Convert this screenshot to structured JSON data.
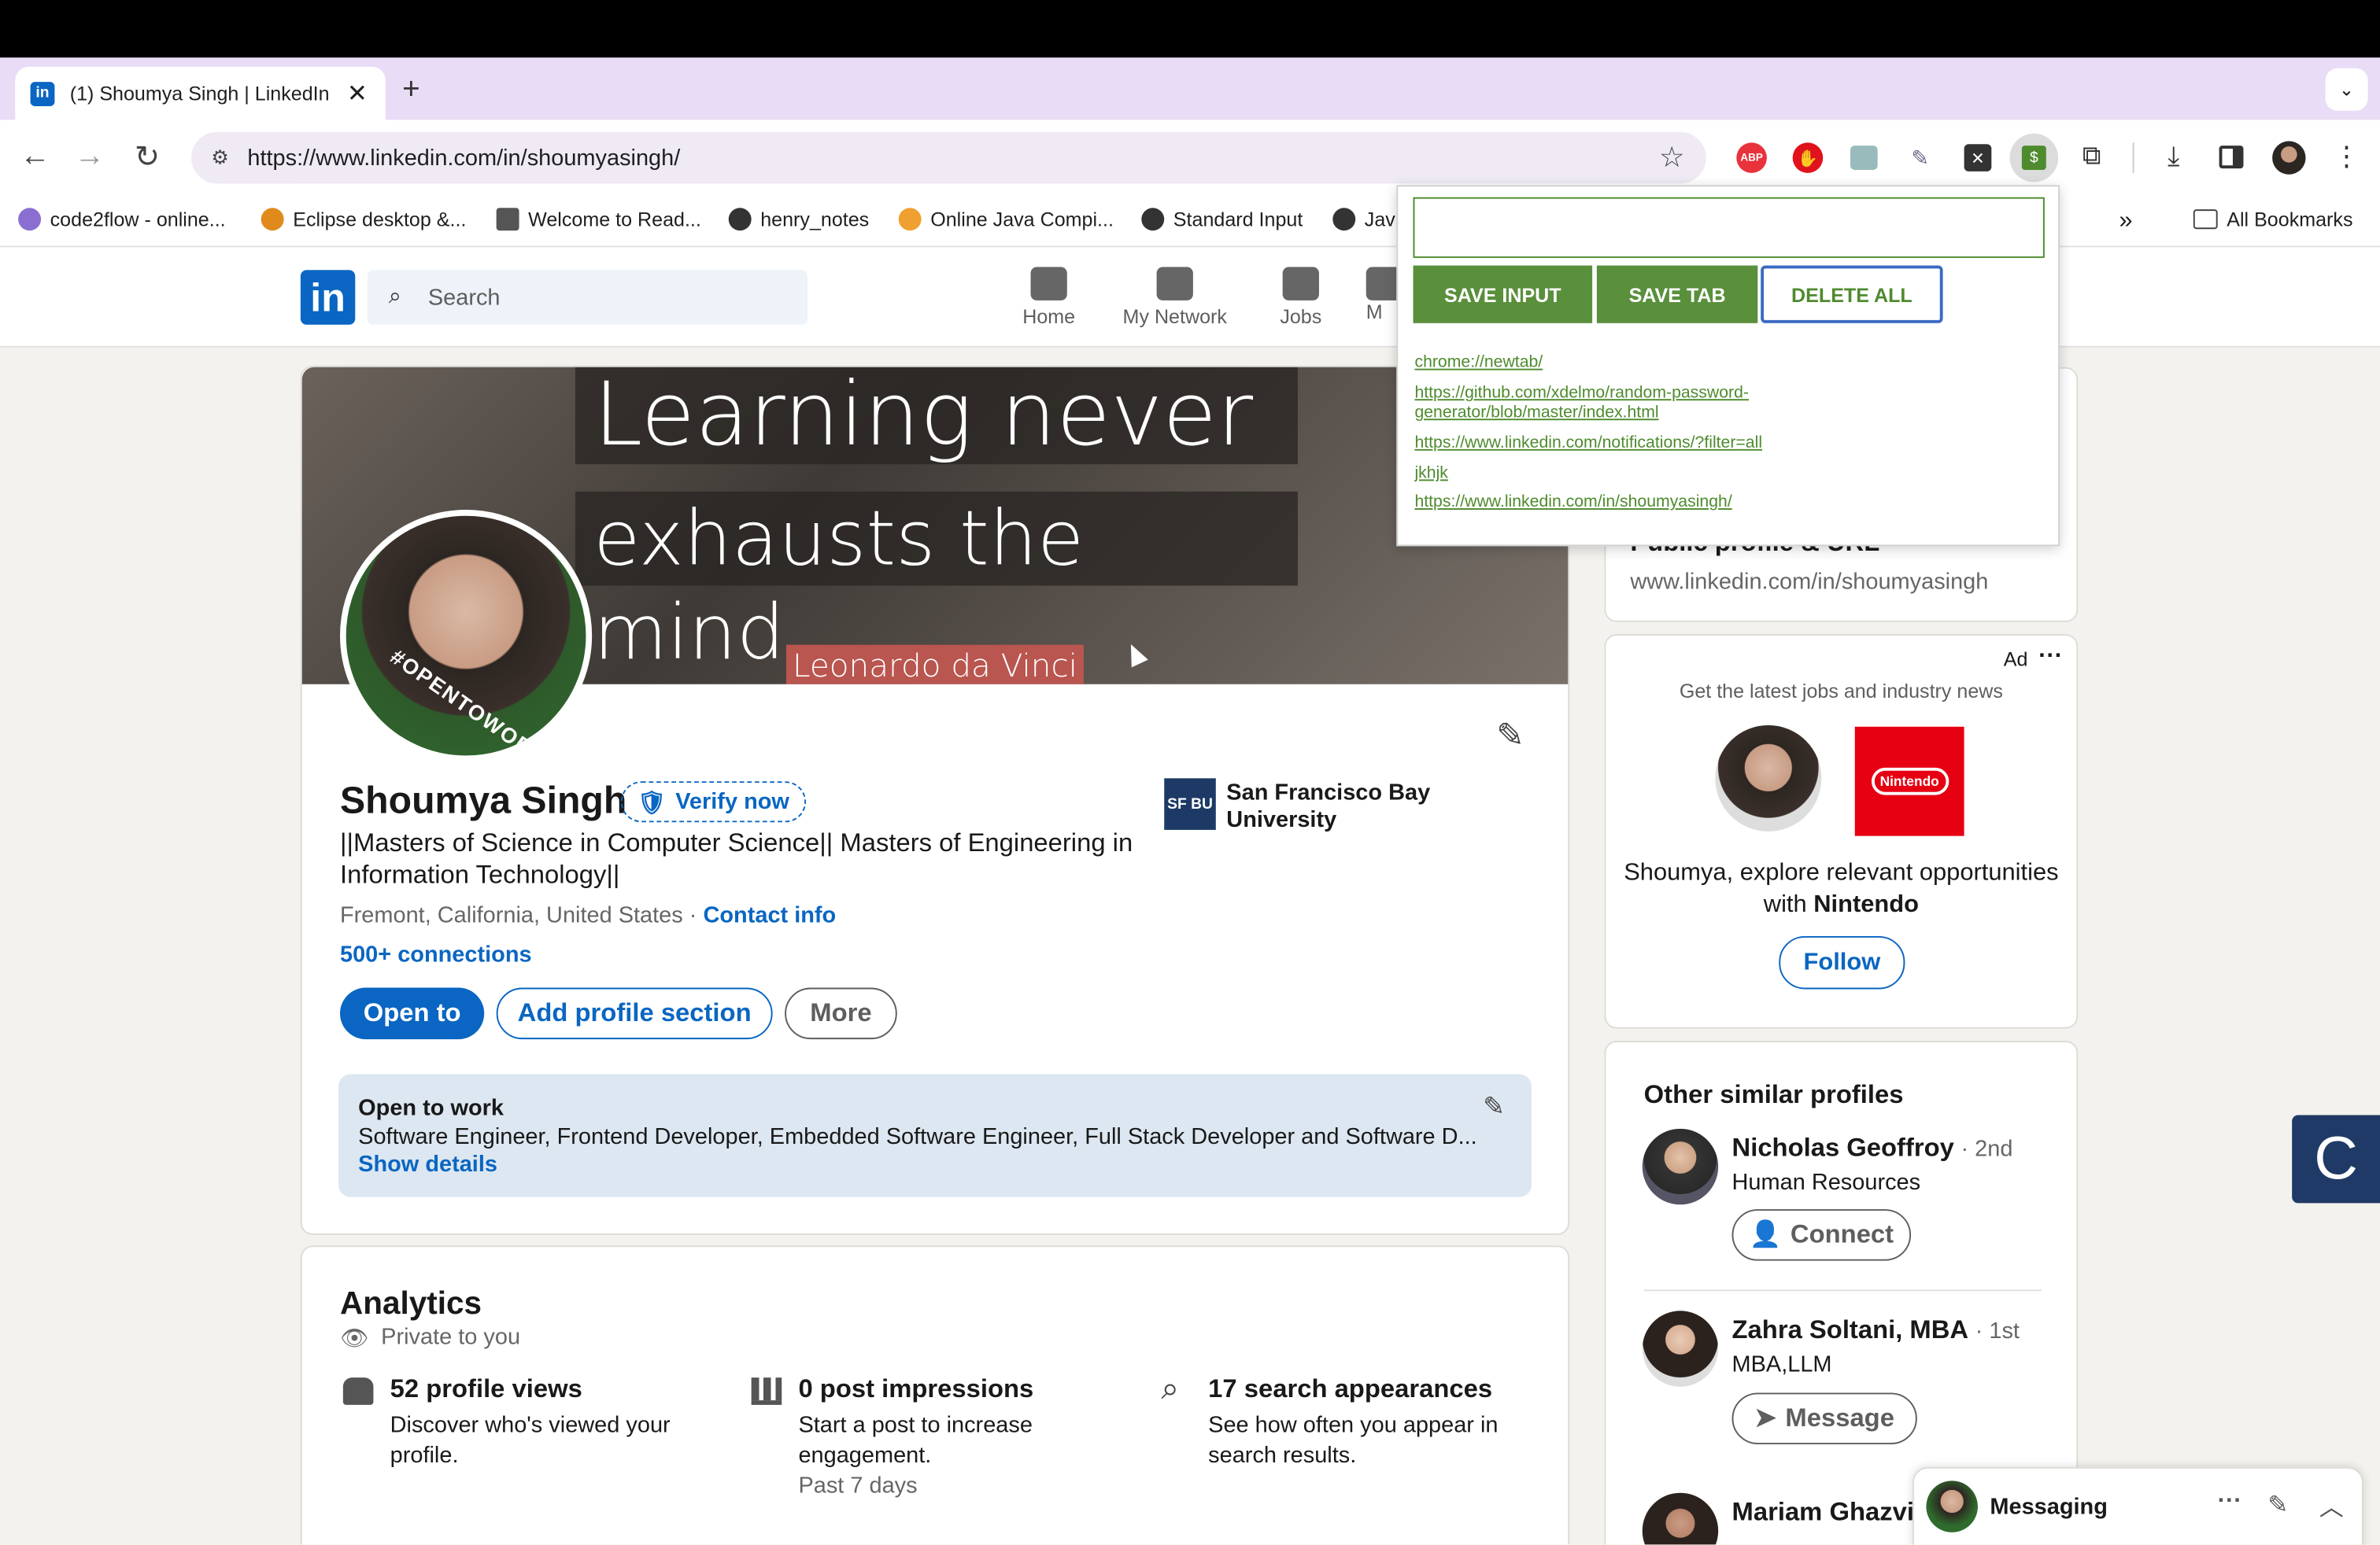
{
  "browser": {
    "tab_title": "(1) Shoumya Singh | LinkedIn",
    "new_tab": "+",
    "url": "https://www.linkedin.com/in/shoumyasingh/",
    "bookmarks": [
      "code2flow - online...",
      "Eclipse desktop &...",
      "Welcome to Read...",
      "henry_notes",
      "Online Java Compi...",
      "Standard Input",
      "Jav"
    ],
    "bookmarks_more": "»",
    "all_bookmarks": "All Bookmarks"
  },
  "nav": {
    "logo": "in",
    "search_placeholder": "Search",
    "items": [
      "Home",
      "My Network",
      "Jobs",
      "M"
    ]
  },
  "cover": {
    "line1": "Learning never",
    "line2": "exhausts the mind.",
    "author": "Leonardo da Vinci",
    "badge": "#OPENTOWORK"
  },
  "profile": {
    "name": "Shoumya Singh",
    "verify": "Verify now",
    "headline": "||Masters of Science in Computer Science|| Masters of Engineering in Information Technology||",
    "location": "Fremont, California, United States",
    "separator": "·",
    "contact": "Contact info",
    "connections": "500+ connections",
    "school": "San Francisco Bay University",
    "school_logo": "SF BU",
    "btn_open": "Open to",
    "btn_add": "Add profile section",
    "btn_more": "More",
    "otw_title": "Open to work",
    "otw_roles": "Software Engineer, Frontend Developer, Embedded Software Engineer, Full Stack Developer and Software D...",
    "otw_details": "Show details"
  },
  "analytics": {
    "title": "Analytics",
    "private": "Private to you",
    "items": [
      {
        "title": "52 profile views",
        "desc": "Discover who's viewed your profile.",
        "extra": ""
      },
      {
        "title": "0 post impressions",
        "desc": "Start a post to increase engagement.",
        "extra": "Past 7 days"
      },
      {
        "title": "17 search appearances",
        "desc": "See how often you appear in search results.",
        "extra": ""
      }
    ]
  },
  "popup": {
    "input_value": "",
    "save_input": "SAVE INPUT",
    "save_tab": "SAVE TAB",
    "delete_all": "DELETE ALL",
    "links": [
      "chrome://newtab/",
      "https://github.com/xdelmo/random-password-generator/blob/master/index.html",
      "https://www.linkedin.com/notifications/?filter=all",
      "jkhjk",
      "https://www.linkedin.com/in/shoumyasingh/"
    ]
  },
  "sidebar": {
    "public_profile_title": "Public profile & URL",
    "public_url": "www.linkedin.com/in/shoumyasingh",
    "ad_label": "Ad",
    "ad_tagline": "Get the latest jobs and industry news",
    "ad_brand": "Nintendo",
    "ad_text_pre": "Shoumya, explore relevant opportunities with",
    "ad_text_brand": "Nintendo",
    "ad_follow": "Follow",
    "similar_title": "Other similar profiles",
    "similar": [
      {
        "name": "Nicholas Geoffroy",
        "degree": "· 2nd",
        "role": "Human Resources",
        "action": "Connect"
      },
      {
        "name": "Zahra Soltani, MBA",
        "degree": "· 1st",
        "role": "MBA,LLM",
        "action": "Message"
      },
      {
        "name": "Mariam Ghazvir",
        "degree": "",
        "role": "",
        "action": ""
      }
    ]
  },
  "messaging": {
    "label": "Messaging"
  },
  "colors": {
    "linkedin_blue": "#0a66c2",
    "ext_green": "#5a8f3c",
    "tab_strip": "#e9dcf6"
  }
}
